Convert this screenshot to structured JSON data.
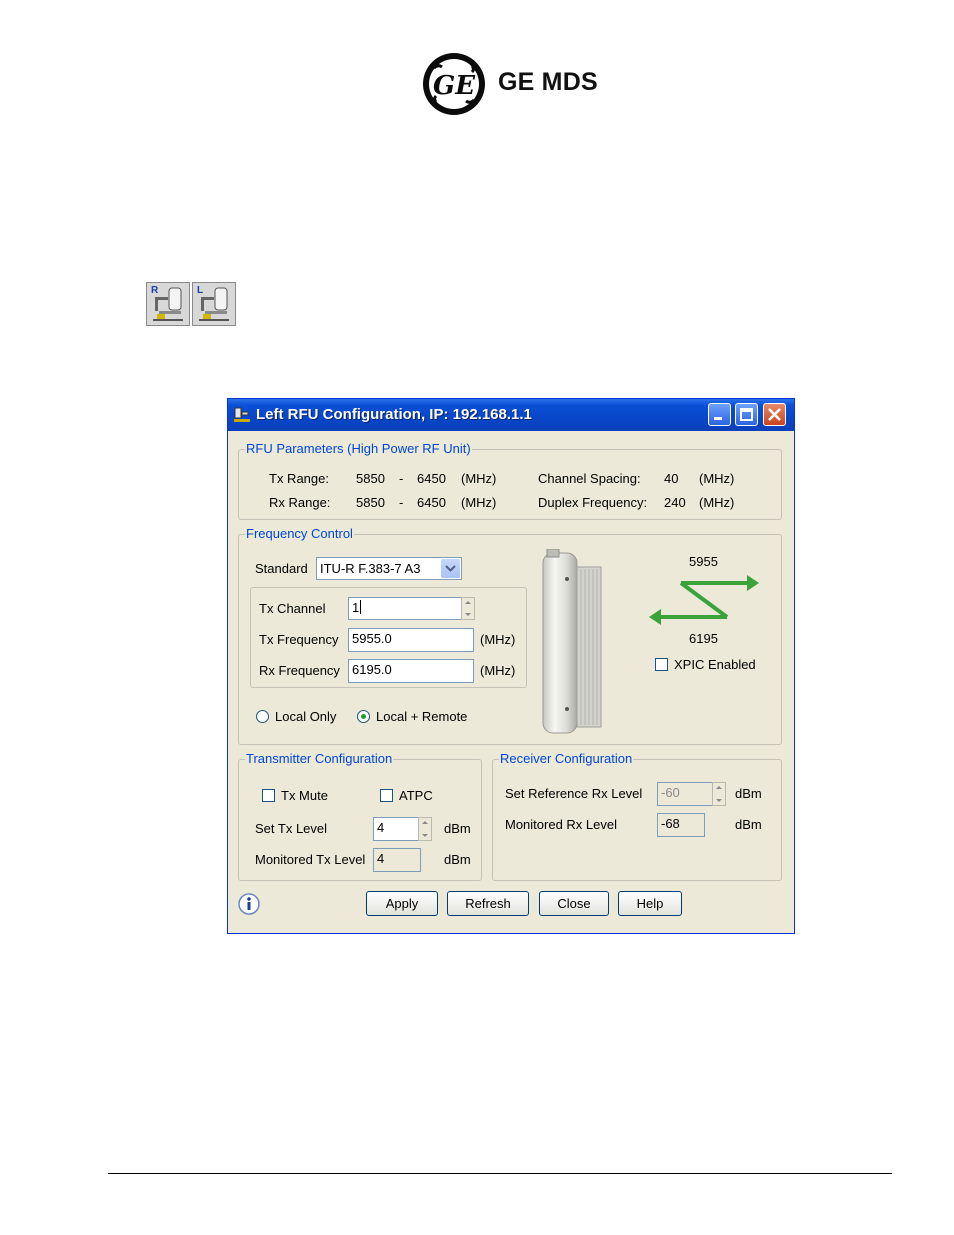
{
  "header": {
    "logo_text": "GE MDS",
    "logo_mark": "GE"
  },
  "toolbar": {
    "right_rfu_letter": "R",
    "left_rfu_letter": "L"
  },
  "dialog": {
    "title": "Left RFU Configuration, IP: 192.168.1.1",
    "rfu_parameters": {
      "group_title": "RFU Parameters (High Power RF Unit)",
      "tx_range_label": "Tx Range:",
      "tx_range_low": "5850",
      "tx_range_high": "6450",
      "rx_range_label": "Rx Range:",
      "rx_range_low": "5850",
      "rx_range_high": "6450",
      "dash": "-",
      "unit": "(MHz)",
      "channel_spacing_label": "Channel Spacing:",
      "channel_spacing_value": "40",
      "duplex_label": "Duplex Frequency:",
      "duplex_value": "240"
    },
    "frequency_control": {
      "group_title": "Frequency Control",
      "standard_label": "Standard",
      "standard_value": "ITU-R F.383-7 A3",
      "tx_channel_label": "Tx Channel",
      "tx_channel_value": "1",
      "tx_freq_label": "Tx Frequency",
      "tx_freq_value": "5955.0",
      "rx_freq_label": "Rx Frequency",
      "rx_freq_value": "6195.0",
      "unit": "(MHz)",
      "local_only_label": "Local Only",
      "local_remote_label": "Local + Remote",
      "selected_mode": "Local + Remote",
      "diagram_top": "5955",
      "diagram_bottom": "6195",
      "xpic_label": "XPIC Enabled",
      "xpic_checked": false
    },
    "transmitter": {
      "group_title": "Transmitter Configuration",
      "tx_mute_label": "Tx Mute",
      "tx_mute_checked": false,
      "atpc_label": "ATPC",
      "atpc_checked": false,
      "set_tx_label": "Set Tx Level",
      "set_tx_value": "4",
      "monitored_tx_label": "Monitored Tx Level",
      "monitored_tx_value": "4",
      "unit": "dBm"
    },
    "receiver": {
      "group_title": "Receiver Configuration",
      "set_ref_label": "Set Reference Rx Level",
      "set_ref_value": "-60",
      "monitored_rx_label": "Monitored Rx Level",
      "monitored_rx_value": "-68",
      "unit": "dBm"
    },
    "buttons": {
      "apply": "Apply",
      "refresh": "Refresh",
      "close": "Close",
      "help": "Help"
    },
    "colors": {
      "titlebar": "#0a4fd6",
      "group_title": "#0046d5",
      "arrow_green": "#3aa33a",
      "dialog_bg": "#ece9d8"
    }
  }
}
